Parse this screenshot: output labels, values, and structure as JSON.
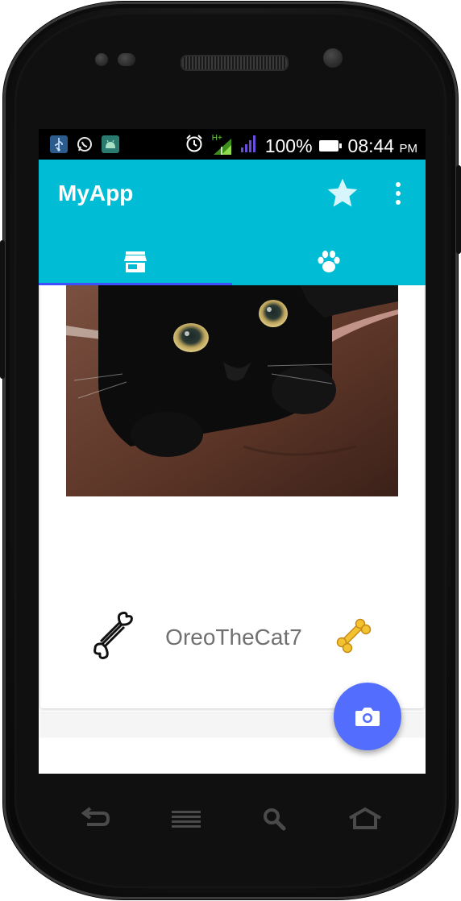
{
  "status_bar": {
    "left_icons": [
      "usb-icon",
      "whatsapp-icon",
      "android-debug-icon"
    ],
    "alarm_icon": "alarm-clock-icon",
    "network_type": "H+",
    "battery_percent": "100%",
    "time": "08:44",
    "ampm": "PM"
  },
  "app_bar": {
    "title": "MyApp",
    "action_icons": [
      "star-icon",
      "more-vert-icon"
    ]
  },
  "tabs": [
    {
      "icon": "store-icon",
      "selected": true
    },
    {
      "icon": "paw-icon",
      "selected": false
    }
  ],
  "card": {
    "photo_alt": "black cat lying on brown blanket",
    "cat_name": "OreoTheCat7",
    "left_icon": "bone-outline-icon",
    "right_icon": "bone-filled-icon"
  },
  "fab": {
    "icon": "camera-icon"
  },
  "nav_keys": [
    "back-icon",
    "menu-icon",
    "search-icon",
    "home-icon"
  ],
  "colors": {
    "primary": "#00bcd4",
    "accent": "#536dfe",
    "tab_indicator": "#3f51ff",
    "bone_fill": "#f2c230"
  }
}
